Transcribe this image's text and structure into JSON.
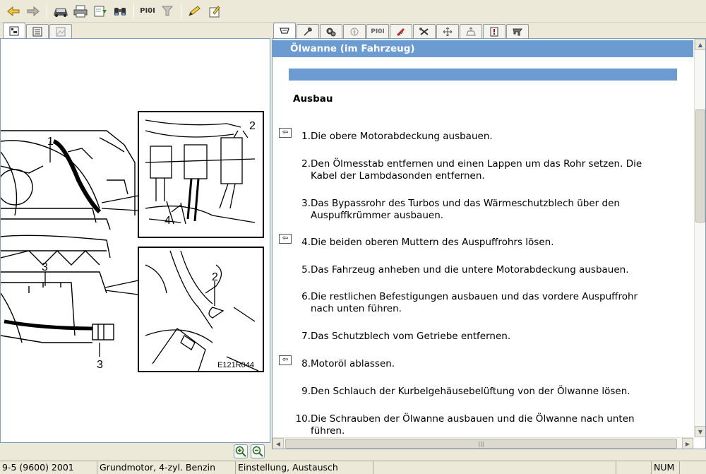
{
  "toolbar": {
    "pioi_label": "PI0I",
    "buttons": [
      "back-arrow-icon",
      "forward-arrow-icon",
      "car-icon",
      "print-icon",
      "download-icon",
      "binoculars-icon",
      "pioi-text",
      "filter-icon",
      "pencil-icon",
      "edit-note-icon"
    ]
  },
  "left_tabs": {
    "pioi_label": "PI0I"
  },
  "right_tabs": {
    "pioi_label": "PI0I"
  },
  "diagram": {
    "label_1": "1",
    "label_2a": "2",
    "label_2b": "2",
    "label_3a": "3",
    "label_3b": "3",
    "label_4": "4",
    "figure_id": "E121R044"
  },
  "document": {
    "title": "Ölwanne (im Fahrzeug)",
    "section": "Ausbau",
    "steps": [
      {
        "num": "1.",
        "text": "Die obere Motorabdeckung ausbauen.",
        "ref": true
      },
      {
        "num": "2.",
        "text": "Den Ölmesstab entfernen und einen Lappen um das Rohr setzen. Die Kabel der Lambdasonden entfernen.",
        "ref": false
      },
      {
        "num": "3.",
        "text": "Das Bypassrohr des Turbos und das Wärmeschutzblech über den Auspuffkrümmer ausbauen.",
        "ref": false
      },
      {
        "num": "4.",
        "text": "Die beiden oberen Muttern des Auspuffrohrs lösen.",
        "ref": true
      },
      {
        "num": "5.",
        "text": "Das Fahrzeug anheben und die untere Motorabdeckung ausbauen.",
        "ref": false
      },
      {
        "num": "6.",
        "text": "Die restlichen Befestigungen ausbauen und das vordere Auspuffrohr nach unten führen.",
        "ref": false
      },
      {
        "num": "7.",
        "text": "Das Schutzblech vom Getriebe entfernen.",
        "ref": false
      },
      {
        "num": "8.",
        "text": "Motoröl ablassen.",
        "ref": true
      },
      {
        "num": "9.",
        "text": "Den Schlauch der Kurbelgehäusebelüftung von der Ölwanne lösen.",
        "ref": false
      },
      {
        "num": "10.",
        "text": "Die Schrauben der Ölwanne ausbauen und die Ölwanne nach unten führen.",
        "ref": false
      }
    ]
  },
  "statusbar": {
    "vehicle": "9-5 (9600) 2001",
    "group": "Grundmotor, 4-zyl. Benzin",
    "category": "Einstellung, Austausch",
    "num": "NUM"
  }
}
